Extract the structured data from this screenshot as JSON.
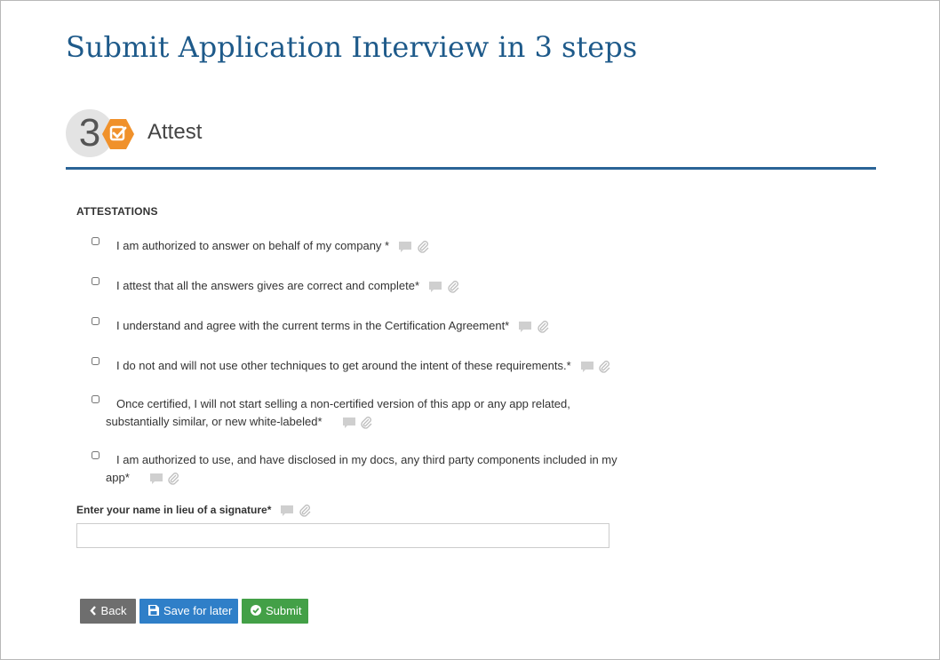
{
  "page": {
    "title": "Submit Application Interview in 3 steps"
  },
  "step": {
    "number": "3",
    "title": "Attest",
    "badge_icon": "check-square-icon",
    "badge_color": "#f0912b"
  },
  "attestations": {
    "heading": "ATTESTATIONS",
    "items": [
      {
        "label": "I am authorized to answer on behalf of my company *"
      },
      {
        "label": "I attest that all the answers gives are correct and complete*"
      },
      {
        "label": "I understand and agree with the current terms in the Certification Agreement*"
      },
      {
        "label": "I do not and will not use other techniques to get around the intent of these requirements.*"
      },
      {
        "label": "Once certified, I will not start selling a non-certified version of this app or any app related, substantially similar, or new white-labeled*"
      },
      {
        "label": "I am authorized to use, and have disclosed in my docs, any third party components included in my app*"
      }
    ]
  },
  "signature": {
    "label": "Enter your name in lieu of a signature*",
    "value": ""
  },
  "buttons": {
    "back": "Back",
    "save": "Save for later",
    "submit": "Submit"
  },
  "colors": {
    "title": "#1e5a8a",
    "rule": "#2a6496",
    "back": "#6e6e6e",
    "save": "#2f7fc8",
    "submit": "#43a047"
  }
}
